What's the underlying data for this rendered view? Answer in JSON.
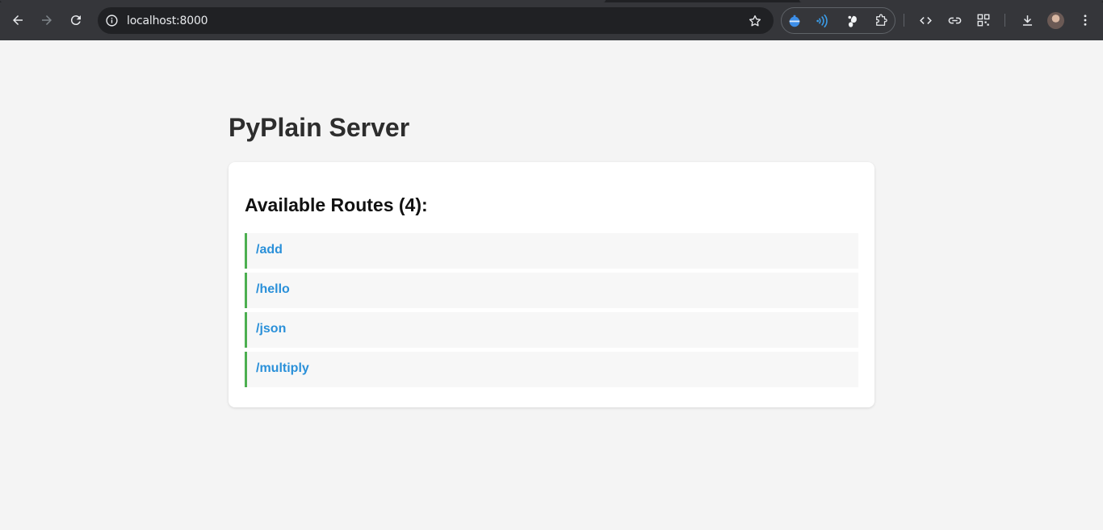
{
  "browser": {
    "url": "localhost:8000",
    "icons": [
      "back-icon",
      "forward-icon",
      "reload-icon",
      "site-info-icon",
      "bookmark-star-icon",
      "extension-icon",
      "cast-icon",
      "gnome-icon",
      "puzzle-icon",
      "code-icon",
      "link-icon",
      "qr-code-icon",
      "download-icon",
      "profile-avatar",
      "menu-icon"
    ]
  },
  "page": {
    "title": "PyPlain Server",
    "routes_heading": "Available Routes (4):",
    "routes": [
      {
        "label": "/add"
      },
      {
        "label": "/hello"
      },
      {
        "label": "/json"
      },
      {
        "label": "/multiply"
      }
    ]
  },
  "colors": {
    "route_accent": "#4caf50",
    "link": "#2a90d9",
    "chrome_bg": "#35363a"
  }
}
